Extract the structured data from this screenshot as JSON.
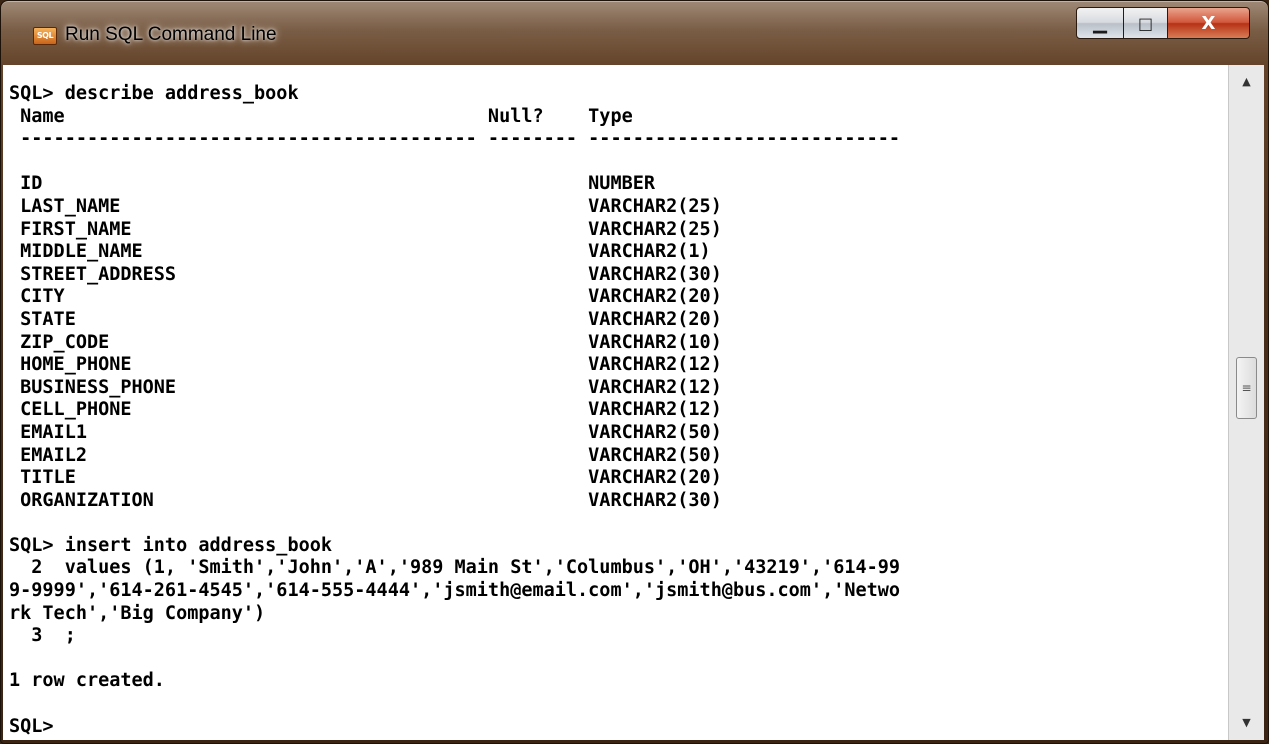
{
  "window": {
    "title": "Run SQL Command Line",
    "icon_label": "SQL",
    "buttons": {
      "minimize": "▁",
      "maximize": "□",
      "close": "X"
    }
  },
  "console": {
    "lines": [
      "SQL> describe address_book",
      " Name                                      Null?    Type",
      " ----------------------------------------- -------- ----------------------------",
      "",
      " ID                                                 NUMBER",
      " LAST_NAME                                          VARCHAR2(25)",
      " FIRST_NAME                                         VARCHAR2(25)",
      " MIDDLE_NAME                                        VARCHAR2(1)",
      " STREET_ADDRESS                                     VARCHAR2(30)",
      " CITY                                               VARCHAR2(20)",
      " STATE                                              VARCHAR2(20)",
      " ZIP_CODE                                           VARCHAR2(10)",
      " HOME_PHONE                                         VARCHAR2(12)",
      " BUSINESS_PHONE                                     VARCHAR2(12)",
      " CELL_PHONE                                         VARCHAR2(12)",
      " EMAIL1                                             VARCHAR2(50)",
      " EMAIL2                                             VARCHAR2(50)",
      " TITLE                                              VARCHAR2(20)",
      " ORGANIZATION                                       VARCHAR2(30)",
      "",
      "SQL> insert into address_book",
      "  2  values (1, 'Smith','John','A','989 Main St','Columbus','OH','43219','614-99",
      "9-9999','614-261-4545','614-555-4444','jsmith@email.com','jsmith@bus.com','Netwo",
      "rk Tech','Big Company')",
      "  3  ;",
      "",
      "1 row created.",
      "",
      "SQL>"
    ]
  },
  "scrollbar": {
    "up_arrow": "▲",
    "down_arrow": "▼",
    "thumb_grip": "≡"
  }
}
